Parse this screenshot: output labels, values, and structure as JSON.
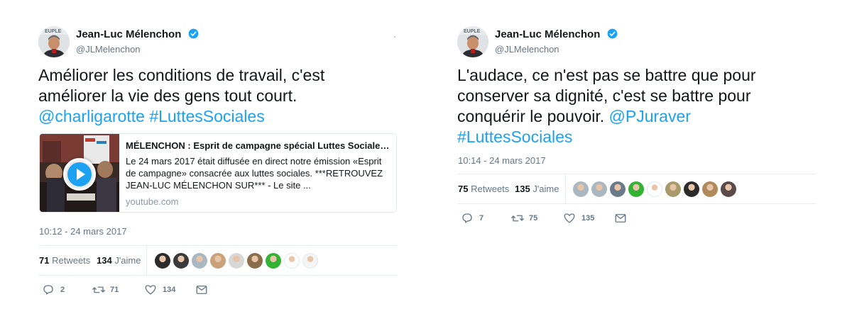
{
  "tweets": [
    {
      "user": {
        "name": "Jean-Luc Mélenchon",
        "handle": "@JLMelenchon",
        "avatar_badge": "EUPLE"
      },
      "text": {
        "line1": "Améliorer les conditions de travail, c'est",
        "line2": "améliorer la vie des gens tout court.",
        "mention": "@charligarotte",
        "hashtag": "#LuttesSociales"
      },
      "card": {
        "title": "MÉLENCHON : Esprit de campagne spécial Luttes Sociale…",
        "description": "Le 24 mars 2017 était diffusée en direct notre émission «Esprit de campagne» consacrée aux luttes sociales. ***RETROUVEZ JEAN-LUC MÉLENCHON SUR*** - Le site ...",
        "domain": "youtube.com"
      },
      "timestamp": "10:12 - 24 mars 2017",
      "stats": {
        "retweets_count": "71",
        "retweets_label": "Retweets",
        "likes_count": "134",
        "likes_label": "J'aime"
      },
      "liker_avatar_colors": [
        "#2b2b2b",
        "#3a3a3a",
        "#aab8c2",
        "#c9a27a",
        "#d8d8d8",
        "#8a6d4a",
        "#34b233",
        "#ffffff",
        "#f5f5f5"
      ],
      "actions": {
        "reply_count": "2",
        "retweet_count": "71",
        "like_count": "134"
      }
    },
    {
      "user": {
        "name": "Jean-Luc Mélenchon",
        "handle": "@JLMelenchon",
        "avatar_badge": "EUPLE"
      },
      "text": {
        "line1": "L'audace, ce n'est pas se battre que pour",
        "line2": "conserver sa dignité, c'est se battre pour",
        "line3": "conquérir le pouvoir.",
        "mention": "@PJuraver",
        "hashtag": "#LuttesSociales"
      },
      "timestamp": "10:14 - 24 mars 2017",
      "stats": {
        "retweets_count": "75",
        "retweets_label": "Retweets",
        "likes_count": "135",
        "likes_label": "J'aime"
      },
      "liker_avatar_colors": [
        "#aab8c2",
        "#aab8c2",
        "#6b7a8a",
        "#34b233",
        "#ffffff",
        "#a89a6a",
        "#2b2b2b",
        "#b08a5a",
        "#5a4a4a"
      ],
      "actions": {
        "reply_count": "7",
        "retweet_count": "75",
        "like_count": "135"
      }
    }
  ],
  "colors": {
    "link": "#1da1f2",
    "meta": "#657786",
    "text": "#14171a",
    "border": "#e6ecf0"
  }
}
